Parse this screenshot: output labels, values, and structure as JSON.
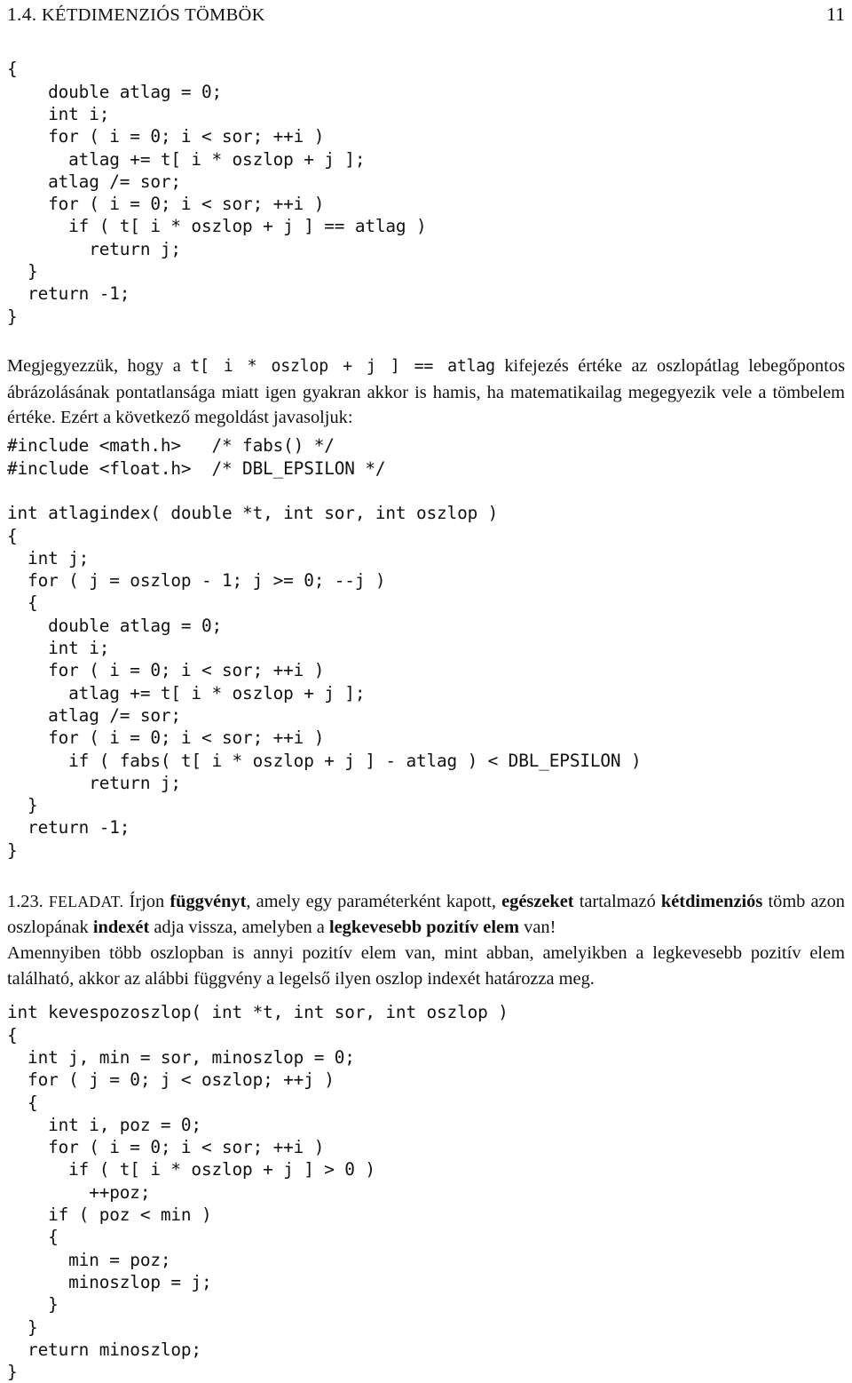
{
  "header": {
    "section_number": "1.4.",
    "section_title": "KÉTDIMENZIÓS TÖMBÖK",
    "page_number": "11"
  },
  "code_block_1": "{\n    double atlag = 0;\n    int i;\n    for ( i = 0; i < sor; ++i )\n      atlag += t[ i * oszlop + j ];\n    atlag /= sor;\n    for ( i = 0; i < sor; ++i )\n      if ( t[ i * oszlop + j ] == atlag )\n        return j;\n  }\n  return -1;\n}",
  "paragraph_note": {
    "text_1": "Megjegyezzük, hogy a ",
    "code_1": "t[ i * oszlop + j ] == atlag",
    "text_2": " kifejezés értéke az oszlopátlag lebegőpontos ábrázolásának pontatlansága miatt igen gyakran akkor is hamis, ha matematikailag megegyezik vele a tömbelem értéke. Ezért a következő megoldást javasoljuk:"
  },
  "code_block_2": "#include <math.h>   /* fabs() */\n#include <float.h>  /* DBL_EPSILON */\n\nint atlagindex( double *t, int sor, int oszlop )\n{\n  int j;\n  for ( j = oszlop - 1; j >= 0; --j )\n  {\n    double atlag = 0;\n    int i;\n    for ( i = 0; i < sor; ++i )\n      atlag += t[ i * oszlop + j ];\n    atlag /= sor;\n    for ( i = 0; i < sor; ++i )\n      if ( fabs( t[ i * oszlop + j ] - atlag ) < DBL_EPSILON )\n        return j;\n  }\n  return -1;\n}",
  "paragraph_task": {
    "number": "1.23.",
    "label": "Feladat.",
    "seg_1": "Írjon ",
    "bold_1": "függvényt",
    "seg_2": ", amely egy paraméterként kapott, ",
    "bold_2": "egészeket",
    "seg_3": " tartalmazó ",
    "bold_3": "kétdimenziós",
    "seg_4": " tömb azon oszlopának ",
    "bold_4": "indexét",
    "seg_5": " adja vissza, amelyben a ",
    "bold_5": "legkevesebb pozitív elem",
    "seg_6": " van!"
  },
  "paragraph_extra": {
    "text": "Amennyiben több oszlopban is annyi pozitív elem van, mint abban, amelyikben a legkevesebb pozitív elem található, akkor az alábbi függvény a legelső ilyen oszlop indexét határozza meg."
  },
  "code_block_3": "int kevespozoszlop( int *t, int sor, int oszlop )\n{\n  int j, min = sor, minoszlop = 0;\n  for ( j = 0; j < oszlop; ++j )\n  {\n    int i, poz = 0;\n    for ( i = 0; i < sor; ++i )\n      if ( t[ i * oszlop + j ] > 0 )\n        ++poz;\n    if ( poz < min )\n    {\n      min = poz;\n      minoszlop = j;\n    }\n  }\n  return minoszlop;\n}"
}
